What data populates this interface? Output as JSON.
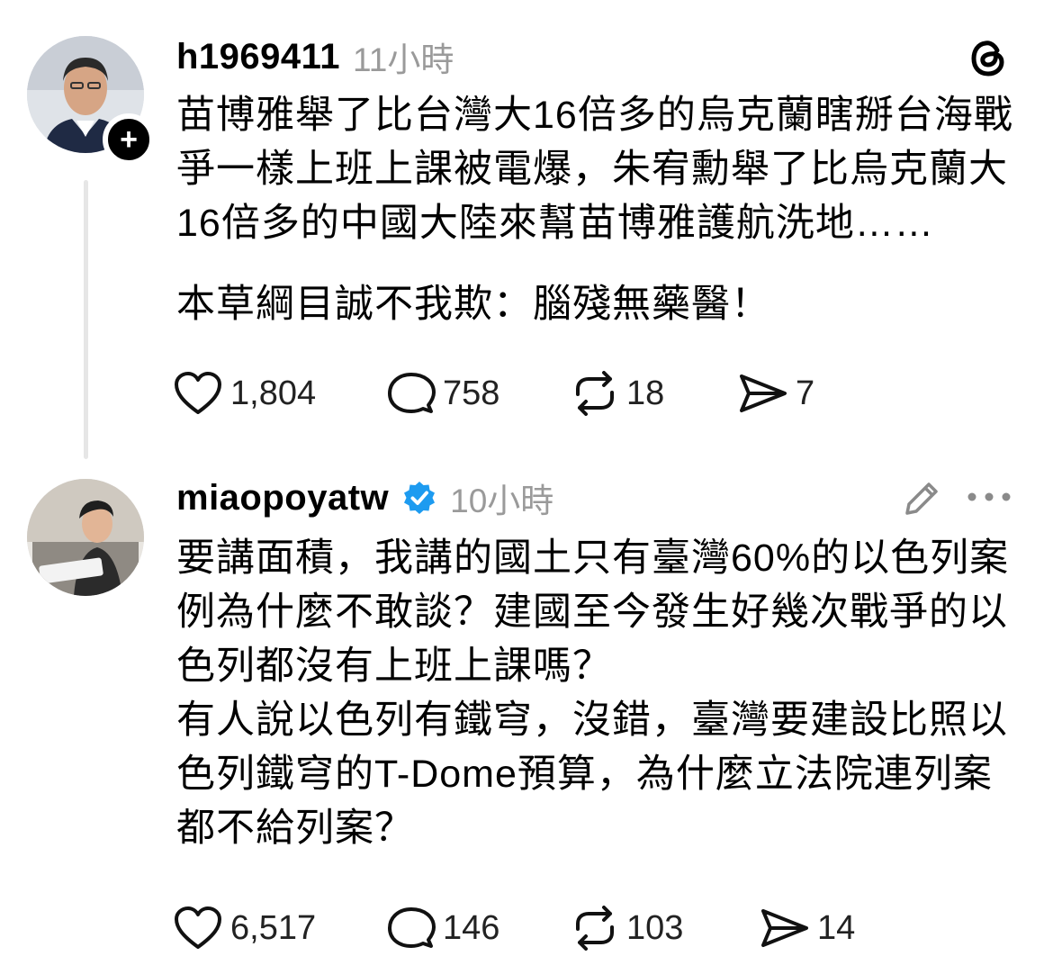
{
  "posts": [
    {
      "username": "h1969411",
      "time": "11小時",
      "paragraphs": [
        "苗博雅舉了比台灣大16倍多的烏克蘭瞎掰台海戰爭一樣上班上課被電爆，朱宥勳舉了比烏克蘭大16倍多的中國大陸來幫苗博雅護航洗地……",
        "本草綱目誠不我欺：腦殘無藥醫！"
      ],
      "stats": {
        "likes": "1,804",
        "replies": "758",
        "reposts": "18",
        "shares": "7"
      }
    },
    {
      "username": "miaopoyatw",
      "time": "10小時",
      "paragraphs": [
        "要講面積，我講的國土只有臺灣60%的以色列案例為什麼不敢談？建國至今發生好幾次戰爭的以色列都沒有上班上課嗎？",
        "有人說以色列有鐵穹，沒錯，臺灣要建設比照以色列鐵穹的T-Dome預算，為什麼立法院連列案都不給列案？"
      ],
      "stats": {
        "likes": "6,517",
        "replies": "146",
        "reposts": "103",
        "shares": "14"
      }
    }
  ],
  "icons": {
    "app_logo": "threads-logo-icon",
    "follow": "plus-icon",
    "verified": "verified-badge-icon",
    "edit": "pencil-icon",
    "more": "more-icon",
    "like": "heart-icon",
    "reply": "comment-icon",
    "repost": "repost-icon",
    "share": "share-icon"
  },
  "colors": {
    "verified": "#1d9bf0",
    "muted": "#9a9a9a",
    "thread_line": "#e6e6e6"
  }
}
